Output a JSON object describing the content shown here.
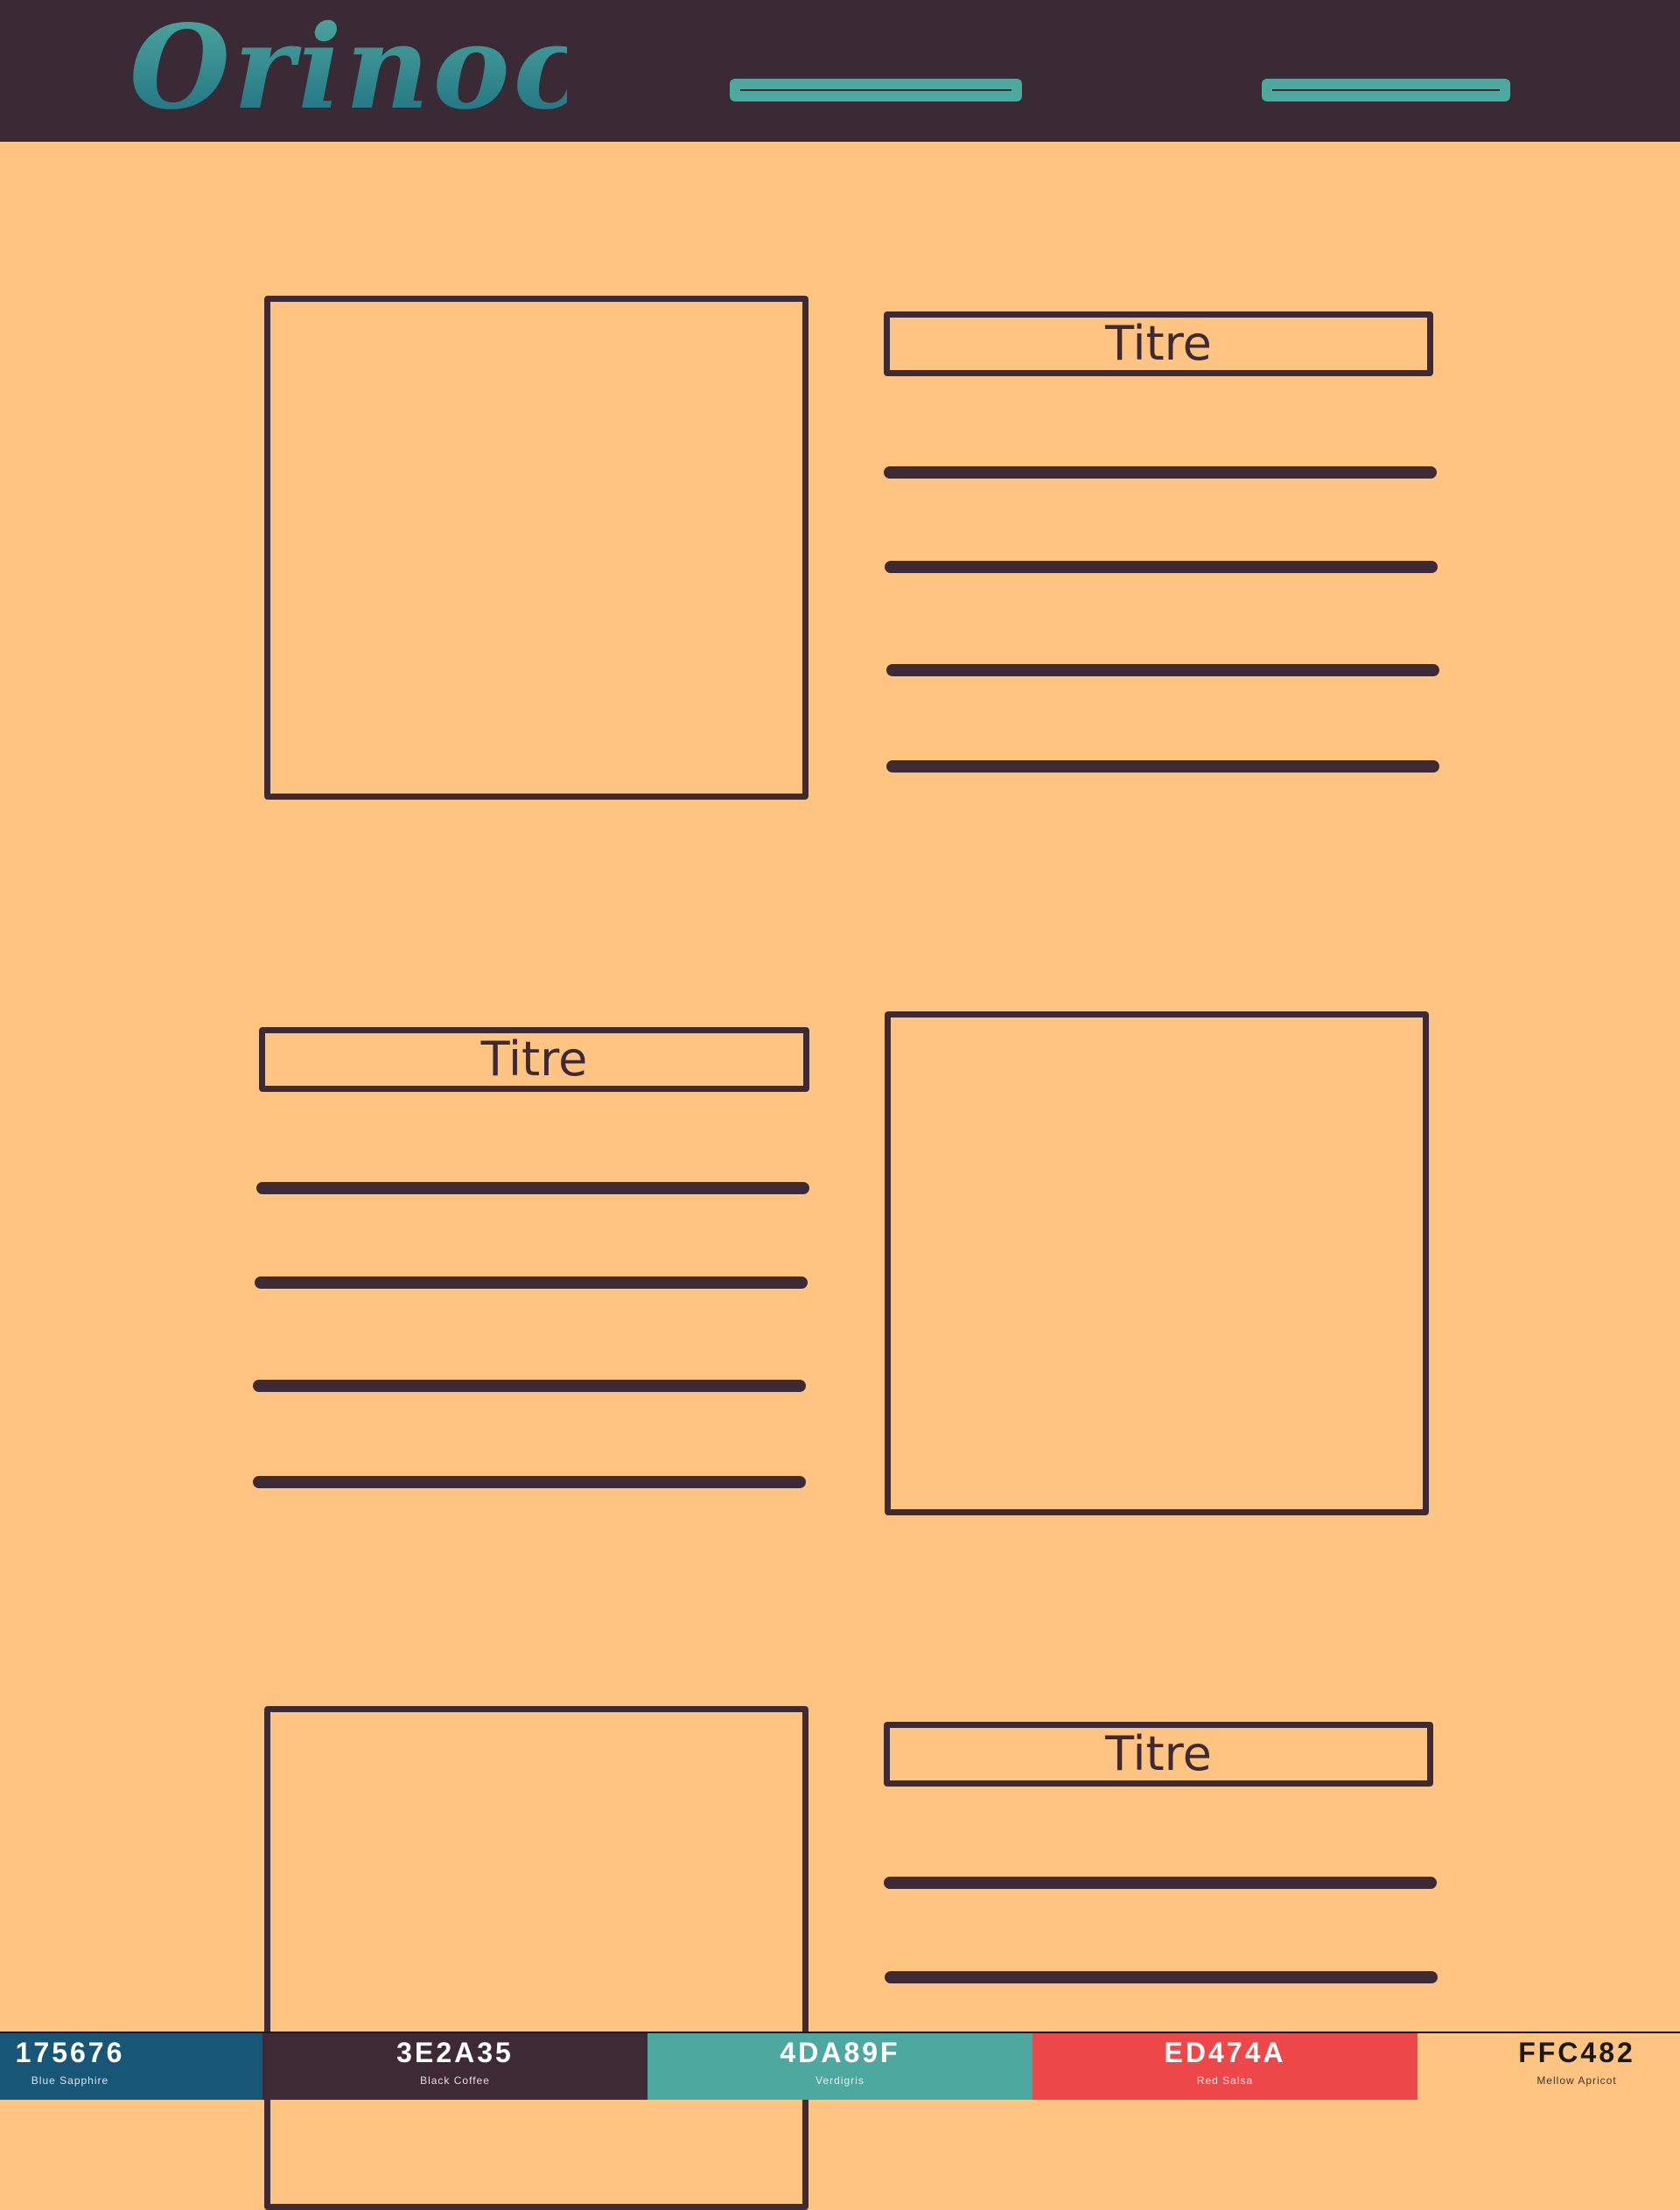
{
  "header": {
    "logo_text": "Orinoco",
    "nav": [
      {
        "label": ""
      },
      {
        "label": ""
      }
    ]
  },
  "sections": [
    {
      "title": "Titre"
    },
    {
      "title": "Titre"
    },
    {
      "title": "Titre"
    }
  ],
  "palette": [
    {
      "hex": "175676",
      "name": "Blue Sapphire",
      "color": "#175676",
      "text_color": "#FFFFFF"
    },
    {
      "hex": "3E2A35",
      "name": "Black Coffee",
      "color": "#3E2A35",
      "text_color": "#FFFFFF"
    },
    {
      "hex": "4DA89F",
      "name": "Verdigris",
      "color": "#4DA89F",
      "text_color": "#FFFFFF"
    },
    {
      "hex": "ED474A",
      "name": "Red Salsa",
      "color": "#ED474A",
      "text_color": "#FFFFFF"
    },
    {
      "hex": "FFC482",
      "name": "Mellow Apricot",
      "color": "#FFC482",
      "text_color": "#1a1a1a"
    }
  ],
  "colors": {
    "header_bg": "#3A2A35",
    "page_bg": "#FFC482",
    "accent": "#4DA89F",
    "ink": "#3E2A35"
  }
}
